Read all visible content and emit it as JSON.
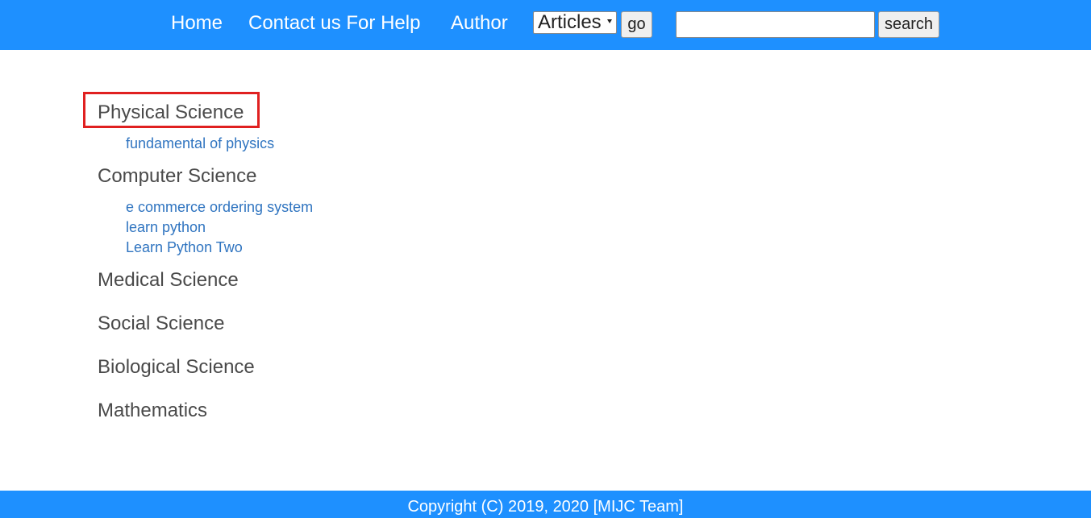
{
  "nav": {
    "home": "Home",
    "contact": "Contact us For Help",
    "author": "Author",
    "articles_select": "Articles",
    "go_label": "go",
    "search_value": "",
    "search_label": "search"
  },
  "categories": [
    {
      "label": "Physical Science",
      "highlighted": true,
      "articles": [
        "fundamental of physics"
      ]
    },
    {
      "label": "Computer Science",
      "articles": [
        "e commerce ordering system",
        "learn python",
        "Learn Python Two"
      ]
    },
    {
      "label": "Medical Science",
      "articles": []
    },
    {
      "label": "Social Science",
      "articles": []
    },
    {
      "label": "Biological Science",
      "articles": []
    },
    {
      "label": "Mathematics",
      "articles": []
    }
  ],
  "footer": {
    "text": "Copyright (C) 2019, 2020 [MIJC Team]"
  },
  "colors": {
    "bar": "#1e90ff",
    "link": "#2f74c0",
    "category": "#4a4a4a",
    "highlight": "#e02020"
  }
}
